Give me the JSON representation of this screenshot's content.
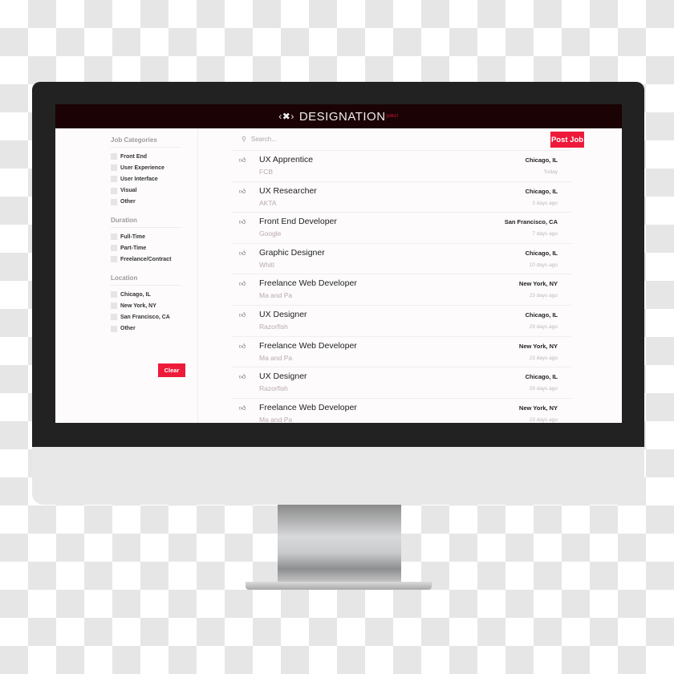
{
  "app": {
    "brand": "DESIGNATION",
    "brand_suffix": "jobs!"
  },
  "sidebar": {
    "groups": [
      {
        "title": "Job Categories",
        "options": [
          "Front End",
          "User Experience",
          "User Interface",
          "Visual",
          "Other"
        ]
      },
      {
        "title": "Duration",
        "options": [
          "Full-Time",
          "Part-Time",
          "Freelance/Contract"
        ]
      },
      {
        "title": "Location",
        "options": [
          "Chicago, IL",
          "New York, NY",
          "San Francisco, CA",
          "Other"
        ]
      }
    ],
    "clear_label": "Clear"
  },
  "search": {
    "placeholder": "Search..."
  },
  "post_job_label": "Post Job",
  "jobs": [
    {
      "title": "UX Apprentice",
      "company": "FCB",
      "location": "Chicago, IL",
      "age": "Today"
    },
    {
      "title": "UX Researcher",
      "company": "AKTA",
      "location": "Chicago, IL",
      "age": "3 days ago"
    },
    {
      "title": "Front End Developer",
      "company": "Google",
      "location": "San Francisco, CA",
      "age": "7 days ago"
    },
    {
      "title": "Graphic Designer",
      "company": "Whitl",
      "location": "Chicago, IL",
      "age": "10 days ago"
    },
    {
      "title": "Freelance Web Developer",
      "company": "Ma and Pa",
      "location": "New York, NY",
      "age": "23 days ago"
    },
    {
      "title": "UX Designer",
      "company": "Razorfish",
      "location": "Chicago, IL",
      "age": "29 days ago"
    },
    {
      "title": "Freelance Web Developer",
      "company": "Ma and Pa",
      "location": "New York, NY",
      "age": "23 days ago"
    },
    {
      "title": "UX Designer",
      "company": "Razorfish",
      "location": "Chicago, IL",
      "age": "29 days ago"
    },
    {
      "title": "Freelance Web Developer",
      "company": "Ma and Pa",
      "location": "New York, NY",
      "age": "23 days ago"
    }
  ],
  "colors": {
    "accent": "#ee1a3a",
    "header": "#1a0205"
  }
}
